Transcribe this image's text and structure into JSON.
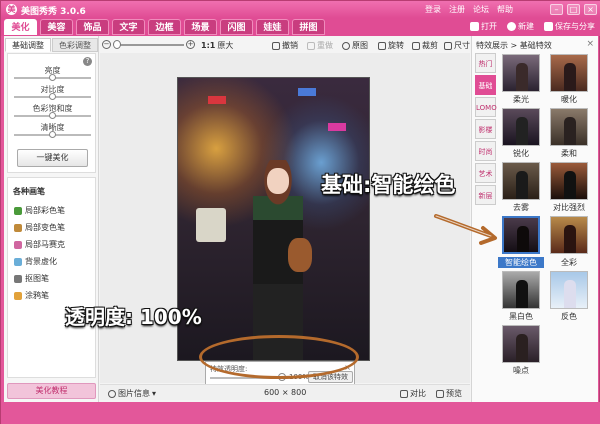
{
  "app": {
    "title": "美图秀秀 3.0.6",
    "logo_glyph": "美"
  },
  "top_links": [
    "登录",
    "注册",
    "论坛",
    "帮助"
  ],
  "window_buttons": [
    "–",
    "□",
    "×"
  ],
  "tabs": [
    "美化",
    "美容",
    "饰品",
    "文字",
    "边框",
    "场景",
    "闪图",
    "娃娃",
    "拼图"
  ],
  "tab_actions": {
    "open": "打开",
    "new": "新建",
    "save_share": "保存与分享"
  },
  "left_panel": {
    "tabs": [
      "基础调整",
      "色彩调整"
    ],
    "adjust_labels": [
      "亮度",
      "对比度",
      "色彩饱和度",
      "清晰度"
    ],
    "help": "?",
    "oneclick_button": "一键美化",
    "brush_title": "各种画笔",
    "brushes": [
      "局部彩色笔",
      "局部变色笔",
      "局部马赛克",
      "背景虚化",
      "抠图笔",
      "涂鸦笔"
    ],
    "tutorial_button": "美化教程"
  },
  "toolbar": {
    "zoom_label": "1:1",
    "original_size": "原大",
    "undo": "撤销",
    "redo": "重做",
    "original": "原图",
    "rotate": "旋转",
    "crop": "裁剪",
    "size": "尺寸"
  },
  "transparency": {
    "label": "特效透明度:",
    "value": "100%",
    "cancel_button": "取消该特效"
  },
  "statusbar": {
    "info": "图片信息",
    "dimensions": "600 × 800",
    "compare": "对比",
    "preview": "预览"
  },
  "right_panel": {
    "breadcrumb": "特效展示 > 基础特效",
    "close": "×",
    "categories": [
      "热门",
      "基础",
      "LOMO",
      "影楼",
      "时尚",
      "艺术",
      "新层"
    ],
    "active_category": "基础",
    "effects": [
      "柔光",
      "暖化",
      "锐化",
      "柔和",
      "去雾",
      "对比强烈",
      "智能绘色",
      "全彩",
      "黑白色",
      "反色",
      "噪点"
    ],
    "selected_effect": "智能绘色"
  },
  "annotations": {
    "effect_callout": "基础:智能绘色",
    "transparency_callout": "透明度: 100%"
  },
  "colors": {
    "accent": "#e04c94",
    "selected": "#3c78c8",
    "annotation": "#b46a2c"
  }
}
